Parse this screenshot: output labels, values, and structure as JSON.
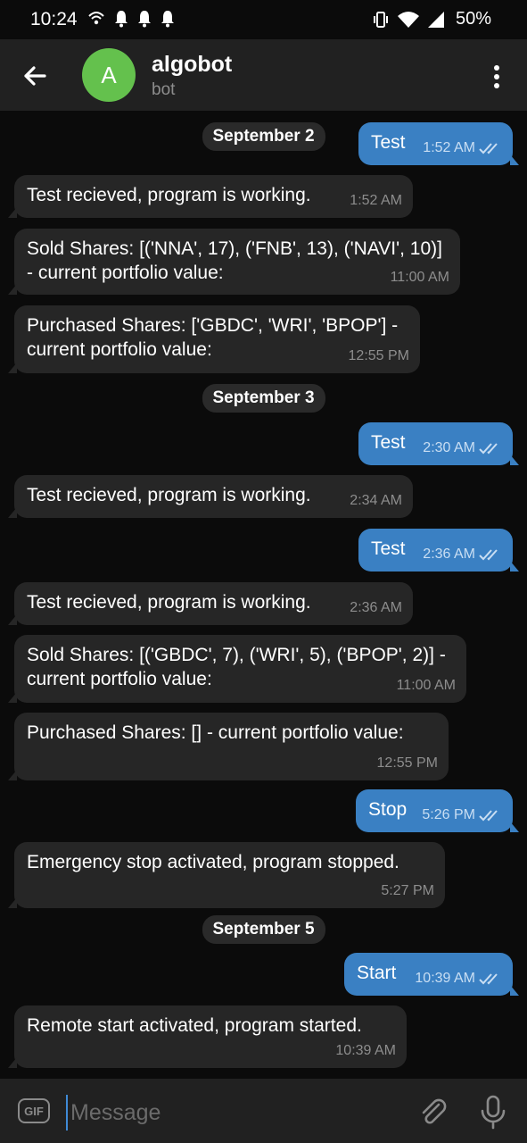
{
  "status_bar": {
    "time": "10:24",
    "battery": "50%",
    "icons": [
      "hotspot-icon",
      "notification-bell-icon",
      "notification-bell-icon",
      "notification-bell-icon",
      "vibrate-icon",
      "wifi-icon",
      "signal-icon"
    ]
  },
  "header": {
    "avatar_letter": "A",
    "avatar_color": "#64c14d",
    "title": "algobot",
    "subtitle": "bot"
  },
  "messages": [
    {
      "type": "date",
      "text": "September 2"
    },
    {
      "type": "out",
      "text": "Test",
      "time": "1:52 AM"
    },
    {
      "type": "in",
      "text": "Test recieved, program is working.",
      "time": "1:52 AM"
    },
    {
      "type": "in",
      "text": "Sold Shares: [('NNA', 17), ('FNB', 13), ('NAVI', 10)] - current portfolio value:",
      "time": "11:00 AM"
    },
    {
      "type": "in",
      "text": "Purchased Shares: ['GBDC', 'WRI', 'BPOP'] - current portfolio value:",
      "time": "12:55 PM"
    },
    {
      "type": "date",
      "text": "September 3"
    },
    {
      "type": "out",
      "text": "Test",
      "time": "2:30 AM"
    },
    {
      "type": "in",
      "text": "Test recieved, program is working.",
      "time": "2:34 AM"
    },
    {
      "type": "out",
      "text": "Test",
      "time": "2:36 AM"
    },
    {
      "type": "in",
      "text": "Test recieved, program is working.",
      "time": "2:36 AM"
    },
    {
      "type": "in",
      "text": "Sold Shares: [('GBDC', 7), ('WRI', 5), ('BPOP', 2)] - current portfolio value:",
      "time": "11:00 AM"
    },
    {
      "type": "in",
      "text": "Purchased Shares: [] - current portfolio value:",
      "time": "12:55 PM"
    },
    {
      "type": "out",
      "text": "Stop",
      "time": "5:26 PM"
    },
    {
      "type": "in",
      "text": "Emergency stop activated, program stopped.",
      "time": "5:27 PM"
    },
    {
      "type": "date",
      "text": "September 5"
    },
    {
      "type": "out",
      "text": "Start",
      "time": "10:39 AM"
    },
    {
      "type": "in",
      "text": "Remote start activated, program started.",
      "time": "10:39 AM"
    }
  ],
  "input": {
    "gif_label": "GIF",
    "placeholder": "Message",
    "value": ""
  },
  "colors": {
    "outgoing_bubble": "#3a80c3",
    "incoming_bubble": "#262626",
    "background": "#0b0b0b",
    "header": "#212121"
  }
}
